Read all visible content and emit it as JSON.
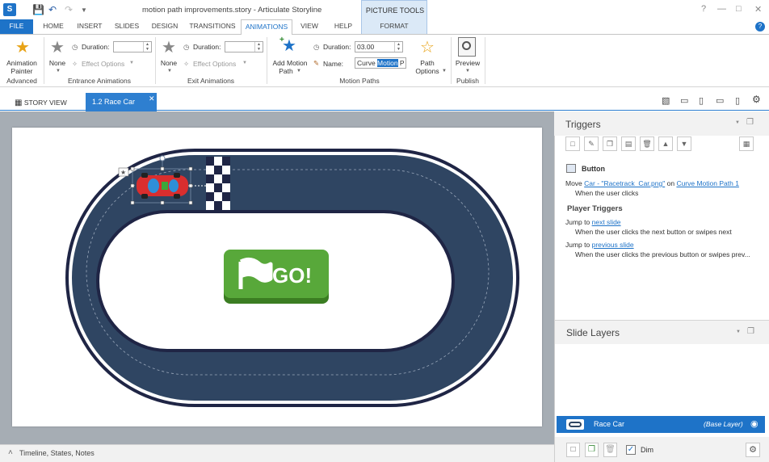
{
  "app": {
    "window_title": "motion path improvements.story - Articulate Storyline",
    "icon_letter": "S",
    "context_tab_group": "PICTURE TOOLS"
  },
  "tabs": [
    {
      "label": "FILE"
    },
    {
      "label": "HOME"
    },
    {
      "label": "INSERT"
    },
    {
      "label": "SLIDES"
    },
    {
      "label": "DESIGN"
    },
    {
      "label": "TRANSITIONS"
    },
    {
      "label": "ANIMATIONS"
    },
    {
      "label": "VIEW"
    },
    {
      "label": "HELP"
    },
    {
      "label": "FORMAT"
    }
  ],
  "ribbon": {
    "advanced": {
      "button_line1": "Animation",
      "button_line2": "Painter",
      "group_label": "Advanced"
    },
    "entrance": {
      "none_label": "None",
      "duration_label": "Duration:",
      "duration_value": "",
      "effect_options": "Effect Options",
      "group_label": "Entrance Animations"
    },
    "exit": {
      "none_label": "None",
      "duration_label": "Duration:",
      "duration_value": "",
      "effect_options": "Effect Options",
      "group_label": "Exit Animations"
    },
    "motion": {
      "add_line1": "Add Motion",
      "add_line2": "Path",
      "duration_label": "Duration:",
      "duration_value": "03.00",
      "name_label": "Name:",
      "name_before": "Curve ",
      "name_selected": "Motion",
      "name_after": " P",
      "path_options_line1": "Path",
      "path_options_line2": "Options",
      "group_label": "Motion Paths"
    },
    "publish": {
      "preview_label": "Preview",
      "group_label": "Publish"
    }
  },
  "doc_tabs": {
    "story_view": "STORY VIEW",
    "slide_tab": "1.2 Race Car"
  },
  "slide": {
    "go_text": "GO!"
  },
  "bottom_bar": {
    "label": "Timeline, States, Notes"
  },
  "triggers": {
    "title": "Triggers",
    "object_name": "Button",
    "trigger1": {
      "action": "Move",
      "target": "Car - \"Racetrack_Car.png\"",
      "connector": "on",
      "path": "Curve Motion Path 1",
      "when": "When the user clicks"
    },
    "player_triggers_title": "Player Triggers",
    "trigger2": {
      "action": "Jump to",
      "target": "next slide",
      "when": "When the user clicks the next button or swipes next"
    },
    "trigger3": {
      "action": "Jump to",
      "target": "previous slide",
      "when": "When the user clicks the previous button or swipes prev..."
    }
  },
  "layers": {
    "title": "Slide Layers",
    "base_layer_name": "Race Car",
    "base_layer_tag": "(Base Layer)",
    "dim_label": "Dim"
  },
  "colors": {
    "accent": "#1e73c8",
    "track": "#2f4562",
    "go_button": "#58a83a"
  }
}
